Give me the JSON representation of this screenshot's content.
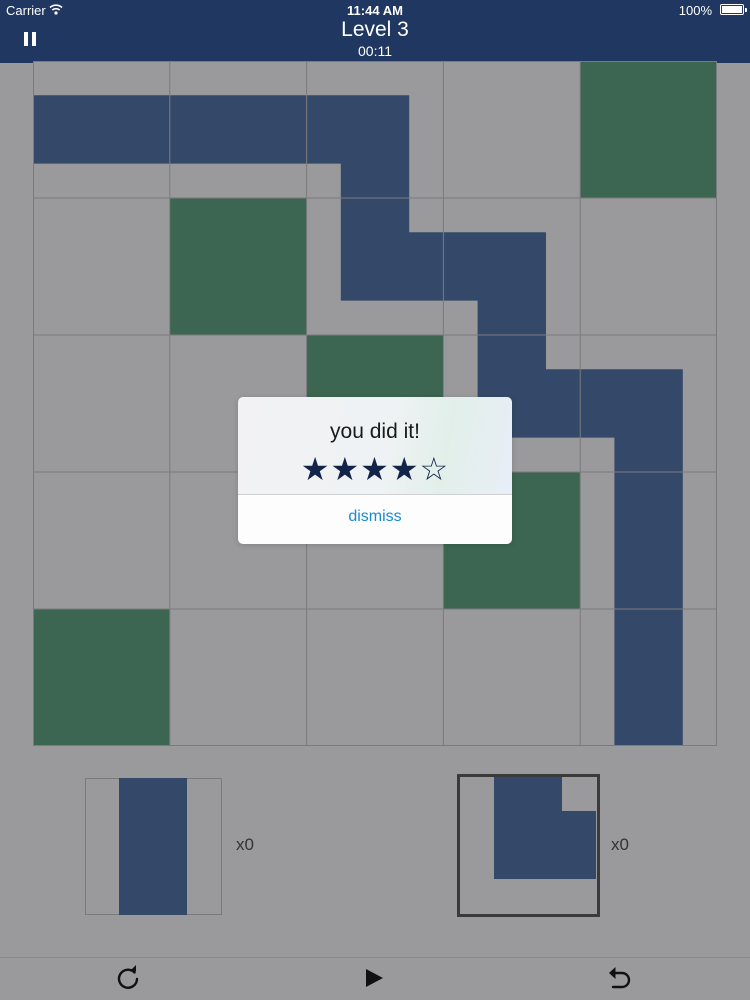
{
  "status_bar": {
    "carrier": "Carrier",
    "time": "11:44 AM",
    "battery": "100%"
  },
  "header": {
    "level": "Level 3",
    "timer": "00:11"
  },
  "colors": {
    "board": "#9a9a9c",
    "path": "#34496a",
    "target": "#3c6651",
    "grid": "#7b7b7d",
    "nav": "#1f3761",
    "star": "#13244a",
    "link": "#1a8ad0"
  },
  "board": {
    "rows": 5,
    "cols": 5,
    "targets": [
      {
        "row": 0,
        "col": 4
      },
      {
        "row": 1,
        "col": 1
      },
      {
        "row": 2,
        "col": 2
      },
      {
        "row": 3,
        "col": 3
      },
      {
        "row": 4,
        "col": 0
      }
    ],
    "path_tiles": [
      {
        "row": 0,
        "col": 0,
        "shape": "horizontal"
      },
      {
        "row": 0,
        "col": 1,
        "shape": "horizontal"
      },
      {
        "row": 0,
        "col": 2,
        "shape": "corner-left-bottom"
      },
      {
        "row": 1,
        "col": 2,
        "shape": "corner-top-right"
      },
      {
        "row": 1,
        "col": 3,
        "shape": "corner-left-bottom"
      },
      {
        "row": 2,
        "col": 3,
        "shape": "corner-top-right"
      },
      {
        "row": 2,
        "col": 4,
        "shape": "corner-left-bottom"
      },
      {
        "row": 3,
        "col": 4,
        "shape": "vertical"
      },
      {
        "row": 4,
        "col": 4,
        "shape": "vertical"
      }
    ]
  },
  "dialog": {
    "title": "you did it!",
    "stars": "★★★★☆",
    "rating": 4,
    "max_rating": 5,
    "dismiss": "dismiss"
  },
  "tray": [
    {
      "shape": "vertical",
      "count": "x0",
      "selected": false
    },
    {
      "shape": "corner-left-bottom",
      "count": "x0",
      "selected": true
    }
  ],
  "toolbar": {
    "icons": [
      "restart-icon",
      "play-icon",
      "undo-icon"
    ]
  }
}
